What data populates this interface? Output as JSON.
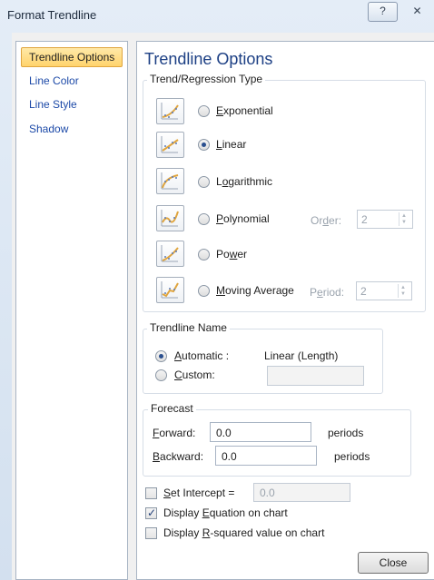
{
  "window": {
    "title": "Format Trendline",
    "help_glyph": "?",
    "close_glyph": "✕"
  },
  "sidebar": {
    "items": [
      {
        "label": "Trendline Options",
        "selected": true
      },
      {
        "label": "Line Color"
      },
      {
        "label": "Line Style"
      },
      {
        "label": "Shadow"
      }
    ]
  },
  "main": {
    "title": "Trendline Options",
    "trend_type": {
      "group_label": "Trend/Regression Type",
      "options": [
        {
          "label": "Exponential",
          "mnemonic_pre": "",
          "mnemonic": "E",
          "mnemonic_post": "xponential",
          "checked": false,
          "icon": "exponential-icon"
        },
        {
          "label": "Linear",
          "mnemonic_pre": "",
          "mnemonic": "L",
          "mnemonic_post": "inear",
          "checked": true,
          "icon": "linear-icon"
        },
        {
          "label": "Logarithmic",
          "mnemonic_pre": "L",
          "mnemonic": "o",
          "mnemonic_post": "garithmic",
          "checked": false,
          "icon": "logarithmic-icon"
        },
        {
          "label": "Polynomial",
          "mnemonic_pre": "",
          "mnemonic": "P",
          "mnemonic_post": "olynomial",
          "checked": false,
          "icon": "polynomial-icon"
        },
        {
          "label": "Power",
          "mnemonic_pre": "Po",
          "mnemonic": "w",
          "mnemonic_post": "er",
          "checked": false,
          "icon": "power-icon"
        },
        {
          "label": "Moving Average",
          "mnemonic_pre": "",
          "mnemonic": "M",
          "mnemonic_post": "oving Average",
          "checked": false,
          "icon": "moving-average-icon"
        }
      ],
      "order": {
        "label_pre": "Or",
        "label_mnemonic": "d",
        "label_post": "er:",
        "value": "2"
      },
      "period": {
        "label_pre": "P",
        "label_mnemonic": "e",
        "label_post": "riod:",
        "value": "2"
      }
    },
    "trendline_name": {
      "group_label": "Trendline Name",
      "automatic": {
        "mnemonic": "A",
        "post": "utomatic :",
        "checked": true,
        "value": "Linear (Length)"
      },
      "custom": {
        "mnemonic": "C",
        "post": "ustom:",
        "checked": false,
        "value": ""
      }
    },
    "forecast": {
      "group_label": "Forecast",
      "forward": {
        "mnemonic": "F",
        "post": "orward:",
        "value": "0.0",
        "unit": "periods"
      },
      "backward": {
        "mnemonic": "B",
        "post": "ackward:",
        "value": "0.0",
        "unit": "periods"
      }
    },
    "checkboxes": {
      "set_intercept": {
        "pre": "",
        "mnemonic": "S",
        "post": "et Intercept =",
        "checked": false,
        "value": "0.0"
      },
      "display_equation": {
        "pre": "Display ",
        "mnemonic": "E",
        "post": "quation on chart",
        "checked": true
      },
      "display_r_squared": {
        "pre": "Display ",
        "mnemonic": "R",
        "post": "-squared value on chart",
        "checked": false
      }
    }
  },
  "footer": {
    "close_label": "Close"
  },
  "colors": {
    "accent": "#1c3f84",
    "nav_selected_bg": "#ffd36c",
    "nav_text": "#1d4aa8"
  }
}
